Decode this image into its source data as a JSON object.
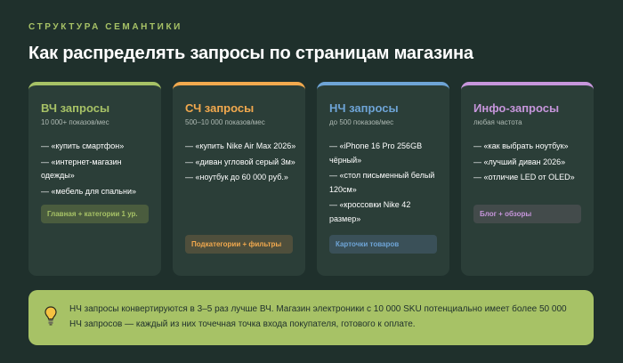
{
  "header": {
    "eyebrow": "СТРУКТУРА СЕМАНТИКИ",
    "title": "Как распределять запросы по страницам магазина"
  },
  "cards": [
    {
      "title": "ВЧ запросы",
      "subtitle": "10 000+ показов/мес",
      "accent": "#a7c266",
      "items": [
        "— «купить смартфон»",
        "— «интернет-магазин одежды»",
        "— «мебель для спальни»"
      ],
      "tag": "Главная + категории 1 ур."
    },
    {
      "title": "СЧ запросы",
      "subtitle": "500–10 000 показов/мес",
      "accent": "#f2a94e",
      "items": [
        "— «купить Nike Air Max 2026»",
        "— «диван угловой серый 3м»",
        "— «ноутбук до 60 000 руб.»"
      ],
      "tag": "Подкатегории + фильтры"
    },
    {
      "title": "НЧ запросы",
      "subtitle": "до 500 показов/мес",
      "accent": "#6ea4d6",
      "items": [
        "— «iPhone 16 Pro 256GB чёрный»",
        "— «стол письменный белый 120см»",
        "— «кроссовки Nike 42 размер»"
      ],
      "tag": "Карточки товаров"
    },
    {
      "title": "Инфо-запросы",
      "subtitle": "любая частота",
      "accent": "#c796dc",
      "items": [
        "— «как выбрать ноутбук»",
        "— «лучший диван 2026»",
        "— «отличие LED от OLED»"
      ],
      "tag": "Блог + обзоры"
    }
  ],
  "tip": {
    "icon": "lightbulb-icon",
    "text": "НЧ запросы конвертируются в 3–5 раз лучше ВЧ. Магазин электроники с 10 000 SKU потенциально имеет более 50 000 НЧ запросов — каждый из них точечная точка входа покупателя, готового к оплате."
  }
}
